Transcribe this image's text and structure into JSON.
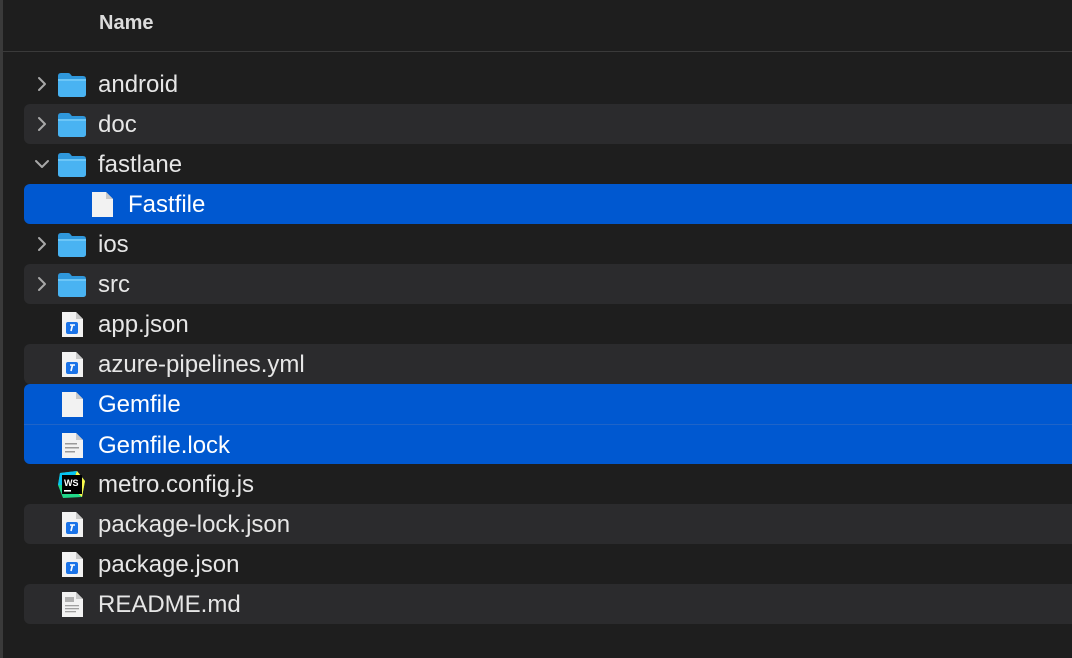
{
  "header": {
    "name_column_label": "Name"
  },
  "files": [
    {
      "name": "android",
      "kind": "folder",
      "icon": "folder-icon",
      "disclosure": "collapsed",
      "depth": 0
    },
    {
      "name": "doc",
      "kind": "folder",
      "icon": "folder-icon",
      "disclosure": "collapsed",
      "depth": 0
    },
    {
      "name": "fastlane",
      "kind": "folder",
      "icon": "folder-icon",
      "disclosure": "expanded",
      "depth": 0
    },
    {
      "name": "Fastfile",
      "kind": "file",
      "icon": "blank-document-icon",
      "disclosure": "none",
      "depth": 1,
      "selected": true
    },
    {
      "name": "ios",
      "kind": "folder",
      "icon": "folder-icon",
      "disclosure": "collapsed",
      "depth": 0
    },
    {
      "name": "src",
      "kind": "folder",
      "icon": "folder-icon",
      "disclosure": "collapsed",
      "depth": 0
    },
    {
      "name": "app.json",
      "kind": "file",
      "icon": "json-document-icon",
      "disclosure": "none",
      "depth": 0
    },
    {
      "name": "azure-pipelines.yml",
      "kind": "file",
      "icon": "json-document-icon",
      "disclosure": "none",
      "depth": 0
    },
    {
      "name": "Gemfile",
      "kind": "file",
      "icon": "blank-document-icon",
      "disclosure": "none",
      "depth": 0,
      "selected": true
    },
    {
      "name": "Gemfile.lock",
      "kind": "file",
      "icon": "text-document-icon",
      "disclosure": "none",
      "depth": 0,
      "selected": true
    },
    {
      "name": "metro.config.js",
      "kind": "file",
      "icon": "webstorm-icon",
      "disclosure": "none",
      "depth": 0
    },
    {
      "name": "package-lock.json",
      "kind": "file",
      "icon": "json-document-icon",
      "disclosure": "none",
      "depth": 0
    },
    {
      "name": "package.json",
      "kind": "file",
      "icon": "json-document-icon",
      "disclosure": "none",
      "depth": 0
    },
    {
      "name": "README.md",
      "kind": "file",
      "icon": "markdown-document-icon",
      "disclosure": "none",
      "depth": 0
    }
  ],
  "colors": {
    "background": "#1e1e1e",
    "alt_row": "#2b2b2d",
    "selection": "#0058d0",
    "folder": "#49b3f2",
    "text": "#e6e6e6"
  }
}
